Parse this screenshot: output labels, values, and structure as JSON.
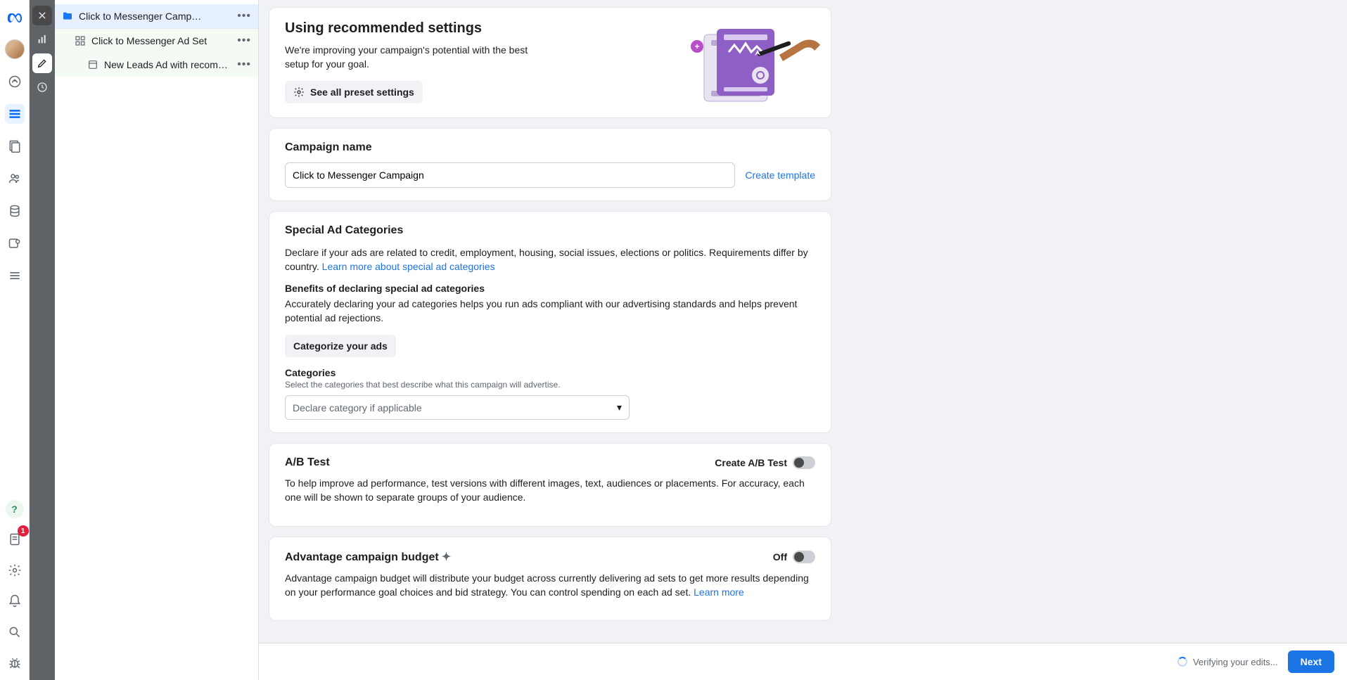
{
  "rail": {
    "notif_count": "1",
    "help_symbol": "?"
  },
  "tree": {
    "campaign": "Click to Messenger Campaign",
    "adset": "Click to Messenger Ad Set",
    "ad": "New Leads Ad with recommend…"
  },
  "hero": {
    "title": "Using recommended settings",
    "subtitle": "We're improving your campaign's potential with the best setup for your goal.",
    "preset_button": "See all preset settings"
  },
  "campaign_name": {
    "title": "Campaign name",
    "value": "Click to Messenger Campaign",
    "template_link": "Create template"
  },
  "special_ad": {
    "title": "Special Ad Categories",
    "desc_pre": "Declare if your ads are related to credit, employment, housing, social issues, elections or politics. Requirements differ by country. ",
    "desc_link": "Learn more about special ad categories",
    "benefit_title": "Benefits of declaring special ad categories",
    "benefit_desc": "Accurately declaring your ad categories helps you run ads compliant with our advertising standards and helps prevent potential ad rejections.",
    "categorize_btn": "Categorize your ads",
    "cat_label": "Categories",
    "cat_hint": "Select the categories that best describe what this campaign will advertise.",
    "cat_placeholder": "Declare category if applicable"
  },
  "abtest": {
    "title": "A/B Test",
    "toggle_label": "Create A/B Test",
    "desc": "To help improve ad performance, test versions with different images, text, audiences or placements. For accuracy, each one will be shown to separate groups of your audience."
  },
  "advantage": {
    "title": "Advantage campaign budget",
    "toggle_label": "Off",
    "desc_pre": "Advantage campaign budget will distribute your budget across currently delivering ad sets to get more results depending on your performance goal choices and bid strategy. You can control spending on each ad set. ",
    "desc_link": "Learn more"
  },
  "footer": {
    "verifying": "Verifying your edits...",
    "next": "Next"
  }
}
